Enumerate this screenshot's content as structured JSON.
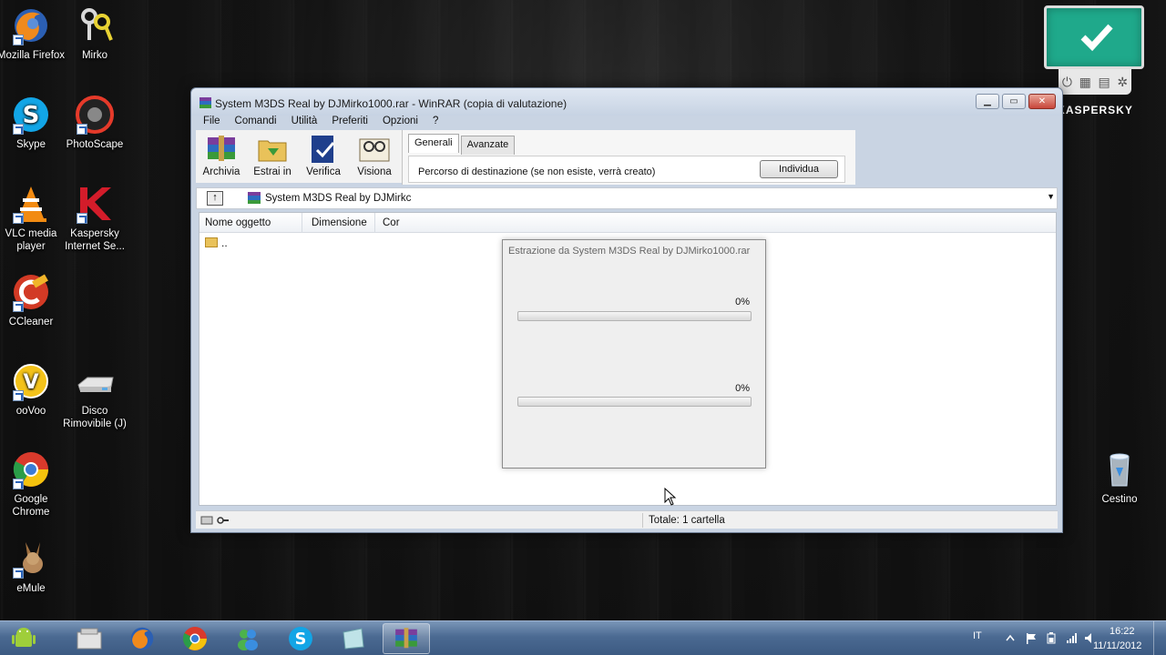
{
  "desktop": {
    "icons": [
      {
        "label": "Mozilla Firefox"
      },
      {
        "label": "Mirko"
      },
      {
        "label": "Skype"
      },
      {
        "label": "PhotoScape"
      },
      {
        "label": "VLC media player"
      },
      {
        "label": "Kaspersky Internet Se..."
      },
      {
        "label": "CCleaner"
      },
      {
        "label": "ooVoo"
      },
      {
        "label": "Disco Rimovibile (J)"
      },
      {
        "label": "Google Chrome"
      },
      {
        "label": "eMule"
      },
      {
        "label": "Cestino"
      }
    ],
    "kaspersky_gadget": {
      "brand": "KASPERSKY",
      "status_color": "#1fa98b"
    }
  },
  "winrar": {
    "title": "System M3DS Real by DJMirko1000.rar - WinRAR (copia di valutazione)",
    "window_buttons": {
      "minimize": "▭",
      "maximize": "▭",
      "close": "✕"
    },
    "menu": [
      "File",
      "Comandi",
      "Utilità",
      "Preferiti",
      "Opzioni",
      "?"
    ],
    "toolbar": [
      {
        "label": "Archivia",
        "icon": "archive-icon"
      },
      {
        "label": "Estrai in",
        "icon": "extract-icon"
      },
      {
        "label": "Verifica",
        "icon": "test-icon"
      },
      {
        "label": "Visiona",
        "icon": "view-icon"
      }
    ],
    "options_panel": {
      "tabs": [
        "Generali",
        "Avanzate"
      ],
      "destination_label": "Percorso di destinazione (se non esiste, verrà creato)",
      "browse_button": "Individua"
    },
    "address": {
      "path": "System M3DS Real by DJMirkc",
      "up_label": "↑"
    },
    "file_list": {
      "columns": [
        "Nome oggetto",
        "Dimensione",
        "Cor"
      ],
      "rows": [
        {
          "name": ".."
        }
      ]
    },
    "status": {
      "total": "Totale: 1 cartella"
    }
  },
  "progress_dialog": {
    "title": "Estrazione da System M3DS Real by DJMirko1000.rar",
    "file_percent_text": "0%",
    "file_progress": 0,
    "total_percent_text": "0%",
    "total_progress": 0
  },
  "taskbar": {
    "language": "IT",
    "time": "16:22",
    "date": "11/11/2012",
    "apps": [
      "android-start-icon",
      "explorer-icon",
      "firefox-icon",
      "chrome-icon",
      "messenger-icon",
      "skype-icon",
      "notes-icon",
      "winrar-icon"
    ]
  }
}
